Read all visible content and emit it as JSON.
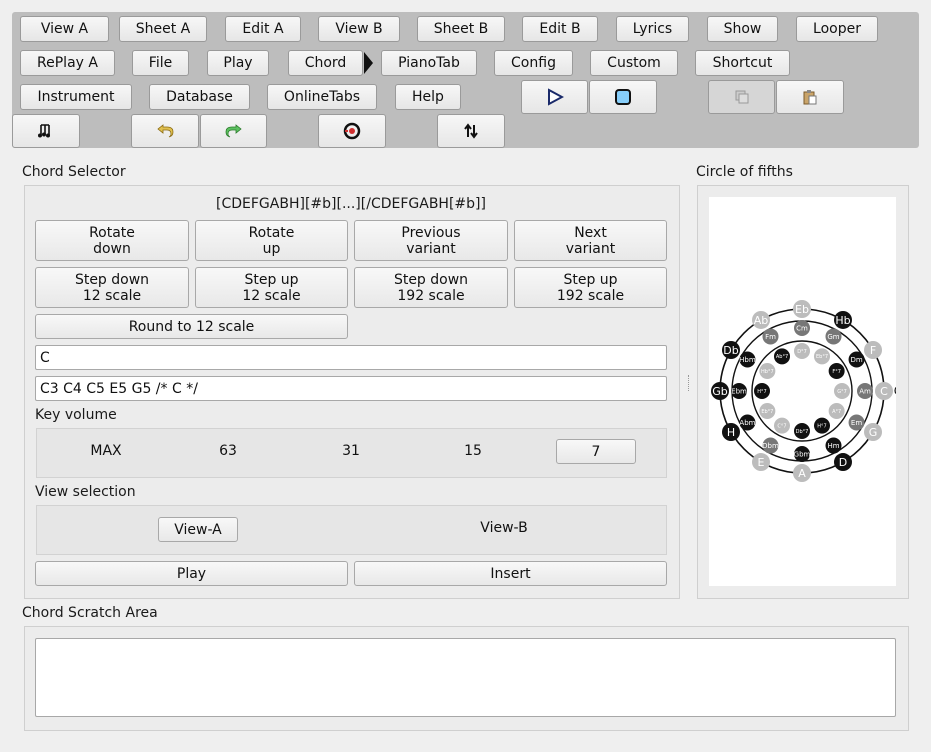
{
  "toolbar": {
    "row1": [
      "View A",
      "Sheet A",
      "Edit A",
      "View B",
      "Sheet B",
      "Edit B",
      "Lyrics",
      "Show",
      "Looper"
    ],
    "row2": [
      "RePlay A",
      "File",
      "Play",
      "Chord",
      "PianoTab",
      "Config",
      "Custom",
      "Shortcut"
    ],
    "row3": [
      "Instrument",
      "Database",
      "OnlineTabs",
      "Help"
    ],
    "icons": [
      "play-icon",
      "stop-icon",
      "copy-icon",
      "paste-icon",
      "notes-icon",
      "undo-icon",
      "redo-icon",
      "record-icon",
      "swap-icon"
    ],
    "accent": "#87cefa"
  },
  "chord_selector": {
    "title": "Chord Selector",
    "hint": "[CDEFGABH][#b][...][/CDEFGABH[#b]]",
    "buttons": [
      [
        "Rotate",
        "down"
      ],
      [
        "Rotate",
        "up"
      ],
      [
        "Previous",
        "variant"
      ],
      [
        "Next",
        "variant"
      ],
      [
        "Step down",
        "12 scale"
      ],
      [
        "Step up",
        "12 scale"
      ],
      [
        "Step down",
        "192 scale"
      ],
      [
        "Step up",
        "192 scale"
      ]
    ],
    "round_label": "Round to 12 scale",
    "chord_value": "C",
    "notes_value": "C3 C4 C5 E5 G5 /* C */",
    "key_volume_label": "Key volume",
    "volumes": [
      "MAX",
      "63",
      "31",
      "15",
      "7"
    ],
    "selected_volume": "7",
    "view_selection_label": "View selection",
    "views": [
      "View-A",
      "View-B"
    ],
    "selected_view": "View-A",
    "play_label": "Play",
    "insert_label": "Insert"
  },
  "circle": {
    "title": "Circle of fifths",
    "outer": [
      "Eb",
      "Hb",
      "F",
      "C",
      "G",
      "D",
      "A",
      "E",
      "H",
      "Gb",
      "Db",
      "Ab"
    ],
    "outer_dark": [
      "Hb",
      "D",
      "H",
      "Gb",
      "Db"
    ],
    "middle": [
      "Cm",
      "Gm",
      "Dm",
      "Am",
      "Em",
      "Hm",
      "Gbm",
      "Dbm",
      "Abm",
      "Ebm",
      "Hbm",
      "Fm"
    ],
    "middle_dark": [
      "Dm",
      "Hm",
      "Gbm",
      "Abm",
      "Ebm",
      "Hbm"
    ],
    "inner": [
      "D°7",
      "Eb°7",
      "F°7",
      "G°7",
      "A°7",
      "H°7",
      "Db°7",
      "C°7",
      "Eb°7",
      "H°7",
      "Hb°7",
      "Ab°7"
    ],
    "inner_dark": [
      "F°7",
      "Db°7",
      "H°7",
      "Ab°7"
    ],
    "colors": {
      "dark": "#111111",
      "mid": "#777777",
      "light": "#bcbcbc"
    }
  },
  "scratch": {
    "title": "Chord Scratch Area",
    "content": ""
  }
}
